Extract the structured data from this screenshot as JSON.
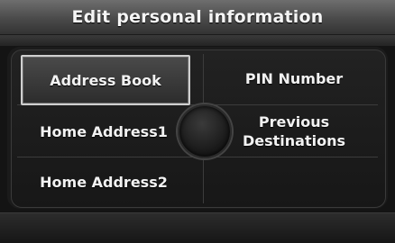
{
  "title": "Edit personal information",
  "menu": {
    "address_book": "Address Book",
    "pin_number": "PIN Number",
    "home_address1": "Home Address1",
    "previous_destinations": "Previous\nDestinations",
    "home_address2": "Home Address2"
  },
  "selected_item": "Address Book"
}
